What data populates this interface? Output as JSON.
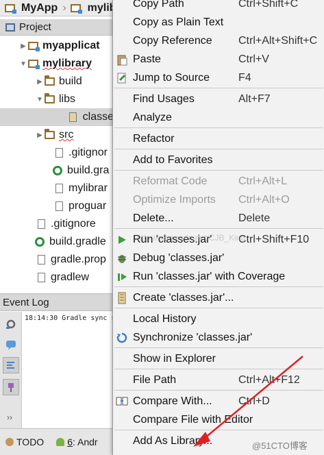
{
  "breadcrumb": [
    {
      "label": "MyApp",
      "icon": "module-folder-icon"
    },
    {
      "label": "mylibrary",
      "icon": "module-folder-icon"
    }
  ],
  "project_panel": {
    "title": "Project",
    "icon": "project-icon"
  },
  "tree": [
    {
      "label": "myapplicat",
      "icon": "module-folder-icon",
      "arrow": "▶",
      "bold": true
    },
    {
      "label": "mylibrary",
      "icon": "module-folder-icon",
      "arrow": "▼",
      "bold": true
    },
    {
      "label": "build",
      "icon": "folder-icon",
      "arrow": "▶"
    },
    {
      "label": "libs",
      "icon": "folder-icon",
      "arrow": "▼"
    },
    {
      "label": "classe",
      "icon": "jar-icon",
      "arrow": ""
    },
    {
      "label": "src",
      "icon": "folder-icon",
      "arrow": "▶"
    },
    {
      "label": ".gitignor",
      "icon": "file-icon",
      "arrow": ""
    },
    {
      "label": "build.gra",
      "icon": "gradle-icon",
      "arrow": ""
    },
    {
      "label": "mylibrar",
      "icon": "file-icon",
      "arrow": ""
    },
    {
      "label": "proguar",
      "icon": "file-icon",
      "arrow": ""
    },
    {
      "label": ".gitignore",
      "icon": "file-icon",
      "arrow": ""
    },
    {
      "label": "build.gradle",
      "icon": "gradle-icon",
      "arrow": ""
    },
    {
      "label": "gradle.prop",
      "icon": "file-icon",
      "arrow": ""
    },
    {
      "label": "gradlew",
      "icon": "file-icon",
      "arrow": ""
    }
  ],
  "event_log": {
    "title": "Event Log",
    "line": "18:14:30 Gradle sync s"
  },
  "statusbar": {
    "todo": "TODO",
    "android_num": "6",
    "android": ": Andr"
  },
  "menu": [
    {
      "label": "Copy Path",
      "shortcut": "Ctrl+Shift+C"
    },
    {
      "label": "Copy as Plain Text",
      "shortcut": ""
    },
    {
      "label": "Copy Reference",
      "shortcut": "Ctrl+Alt+Shift+C"
    },
    {
      "label": "Paste",
      "shortcut": "Ctrl+V",
      "icon": "paste-icon"
    },
    {
      "label": "Jump to Source",
      "shortcut": "F4",
      "icon": "jump-to-source-icon"
    },
    {
      "label": "Find Usages",
      "shortcut": "Alt+F7"
    },
    {
      "label": "Analyze",
      "shortcut": ""
    },
    {
      "label": "Refactor",
      "shortcut": ""
    },
    {
      "label": "Add to Favorites",
      "shortcut": ""
    },
    {
      "label": "Reformat Code",
      "shortcut": "Ctrl+Alt+L",
      "disabled": true
    },
    {
      "label": "Optimize Imports",
      "shortcut": "Ctrl+Alt+O",
      "disabled": true
    },
    {
      "label": "Delete...",
      "shortcut": "Delete"
    },
    {
      "label": "Run 'classes.jar'",
      "shortcut": "Ctrl+Shift+F10",
      "icon": "run-icon"
    },
    {
      "label": "Debug 'classes.jar'",
      "shortcut": "",
      "icon": "debug-icon"
    },
    {
      "label": "Run 'classes.jar' with Coverage",
      "shortcut": "",
      "icon": "coverage-icon"
    },
    {
      "label": "Create 'classes.jar'...",
      "shortcut": "",
      "icon": "create-config-icon"
    },
    {
      "label": "Local History",
      "shortcut": ""
    },
    {
      "label": "Synchronize 'classes.jar'",
      "shortcut": "",
      "icon": "sync-icon"
    },
    {
      "label": "Show in Explorer",
      "shortcut": ""
    },
    {
      "label": "File Path",
      "shortcut": "Ctrl+Alt+F12"
    },
    {
      "label": "Compare With...",
      "shortcut": "Ctrl+D",
      "icon": "compare-icon"
    },
    {
      "label": "Compare File with Editor",
      "shortcut": ""
    },
    {
      "label": "Add As Library...",
      "shortcut": ""
    }
  ],
  "watermarks": {
    "middle": "http://blog.csdn.net/CJB_King",
    "corner": "@51CTO博客"
  },
  "colors": {
    "arrow_annotation": "#e02020",
    "menu_background": "#f2f2f2",
    "selection": "#d4d4d4"
  }
}
